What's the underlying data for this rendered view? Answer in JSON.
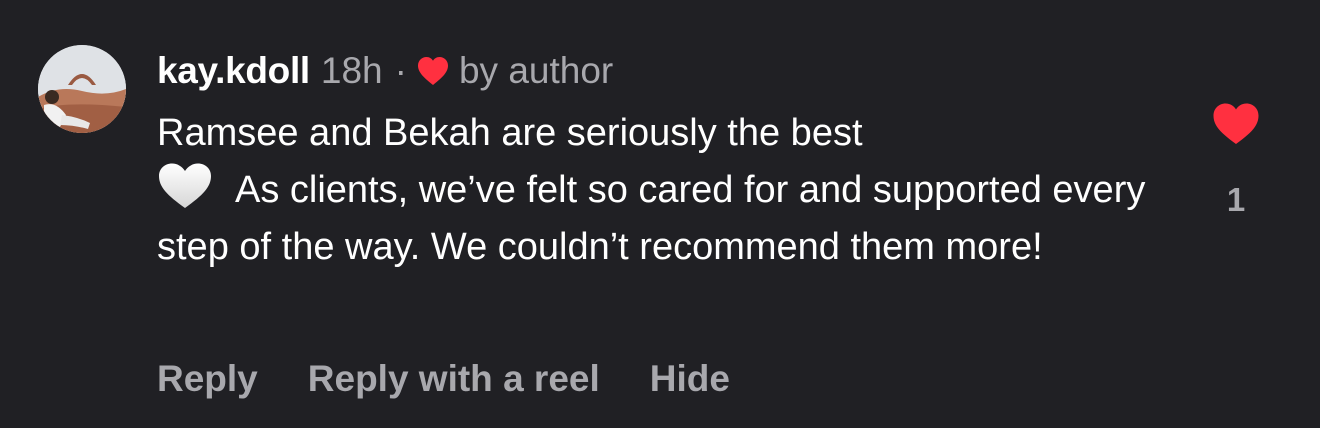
{
  "comment": {
    "username": "kay.kdoll",
    "time": "18h",
    "separator": "·",
    "liked_by_label": "by author",
    "text_line1": "Ramsee and Bekah are seriously the best",
    "text_rest": "As clients, we’ve felt so cared for and supported every step of the way. We couldn’t recommend them more!",
    "like_count": "1"
  },
  "actions": {
    "reply_label": "Reply",
    "reply_reel_label": "Reply with a reel",
    "hide_label": "Hide"
  },
  "colors": {
    "background": "#202024",
    "text": "#ffffff",
    "muted": "#a8a8ad",
    "heart_red": "#ff3040"
  }
}
